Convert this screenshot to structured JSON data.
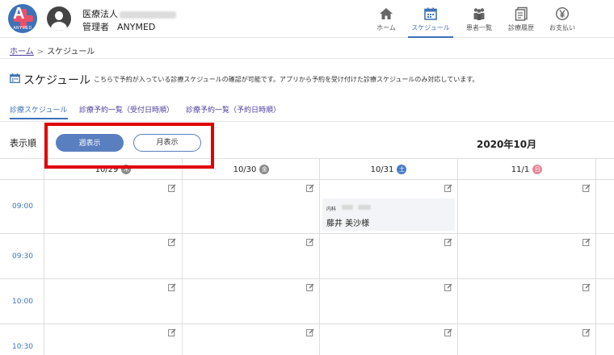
{
  "header": {
    "logo_text": "ANYMED",
    "org_name": "医療法人",
    "role_label": "管理者",
    "user_name": "ANYMED",
    "nav": [
      {
        "label": "ホーム",
        "icon": "home-icon"
      },
      {
        "label": "スケジュール",
        "icon": "calendar-icon",
        "active": true
      },
      {
        "label": "患者一覧",
        "icon": "patients-icon"
      },
      {
        "label": "診療履歴",
        "icon": "history-icon"
      },
      {
        "label": "お支払い",
        "icon": "yen-icon"
      }
    ]
  },
  "breadcrumb": {
    "home": "ホーム",
    "sep": ">",
    "current": "スケジュール"
  },
  "page": {
    "title": "スケジュール",
    "description": "こちらで予約が入っている診療スケジュールの確認が可能です。アプリから予約を受け付けた診療スケジュールのみ対応しています。"
  },
  "tabs": [
    {
      "label": "診療スケジュール",
      "active": true
    },
    {
      "label": "診療予約一覧（受付日時順）"
    },
    {
      "label": "診療予約一覧（予約日時順）"
    }
  ],
  "controls": {
    "display_label": "表示順",
    "week_button": "週表示",
    "month_button": "月表示",
    "month_title": "2020年10月"
  },
  "calendar": {
    "days": [
      {
        "date": "10/29",
        "weekday": "木",
        "color": "#8a8a8a"
      },
      {
        "date": "10/30",
        "weekday": "金",
        "color": "#8a8a8a"
      },
      {
        "date": "10/31",
        "weekday": "土",
        "color": "#4a7cc4"
      },
      {
        "date": "11/1",
        "weekday": "日",
        "color": "#e8889a"
      }
    ],
    "times": [
      "09:00",
      "09:30",
      "10:00",
      "10:30"
    ],
    "appointment": {
      "dept": "内科",
      "patient": "藤井 美沙様"
    }
  },
  "colors": {
    "accent": "#3d72b8",
    "link": "#4a3c9c",
    "highlight": "#e00000"
  }
}
